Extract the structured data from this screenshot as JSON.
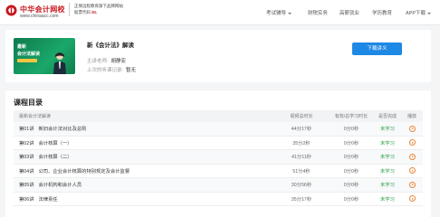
{
  "header": {
    "logo_name": "中华会计网校",
    "logo_url": "www.chinaacc.com",
    "slogan_line1": "正保远程教育旗下品牌网站",
    "slogan_line2_prefix": "股票代码",
    "slogan_line2_code": "DL",
    "nav": [
      {
        "label": "考试辅导",
        "has_dropdown": true
      },
      {
        "label": "财税实务",
        "has_dropdown": false
      },
      {
        "label": "高薪就业",
        "has_dropdown": false
      },
      {
        "label": "学历教育",
        "has_dropdown": false
      },
      {
        "label": "APP下载",
        "has_dropdown": true
      }
    ]
  },
  "course": {
    "thumb_line1": "最新",
    "thumb_line2": "会计法解读",
    "title": "新《会计法》解读",
    "teacher_label": "主讲老师:",
    "teacher_value": "胡静宏",
    "last_label": "上次的听课记录:",
    "last_value": "暂无",
    "download_label": "下载讲义"
  },
  "catalog": {
    "title": "课程目录",
    "columns": {
      "title": "最新会计法解读",
      "duration": "视频总时长",
      "watched": "有效/总学习时长",
      "status": "是否完成",
      "play": "播放"
    },
    "rows": [
      {
        "no": "第01讲",
        "title": "新旧会计法对比及总则",
        "duration": "44分17秒",
        "watched": "0分0秒",
        "status": "未学习"
      },
      {
        "no": "第02讲",
        "title": "会计核算（一）",
        "duration": "35分2秒",
        "watched": "0分0秒",
        "status": "未学习"
      },
      {
        "no": "第03讲",
        "title": "会计核算（二）",
        "duration": "41分11秒",
        "watched": "0分0秒",
        "status": "未学习"
      },
      {
        "no": "第04讲",
        "title": "公司、企业会计核算的特别规定及会计监督",
        "duration": "51分4秒",
        "watched": "0分0秒",
        "status": "未学习"
      },
      {
        "no": "第05讲",
        "title": "会计机构和会计人员",
        "duration": "30分56秒",
        "watched": "0分0秒",
        "status": "未学习"
      },
      {
        "no": "第06讲",
        "title": "法律责任",
        "duration": "35分17秒",
        "watched": "0分0秒",
        "status": "未学习"
      }
    ]
  },
  "colors": {
    "brand_red": "#c8161d",
    "button_blue": "#1e88e5",
    "status_green": "#2a9d4a",
    "play_orange": "#e7863a"
  },
  "icons": {
    "logo": "chinaacc-logo-icon",
    "play": "play-circle-icon",
    "dropdown": "chevron-down-icon"
  }
}
